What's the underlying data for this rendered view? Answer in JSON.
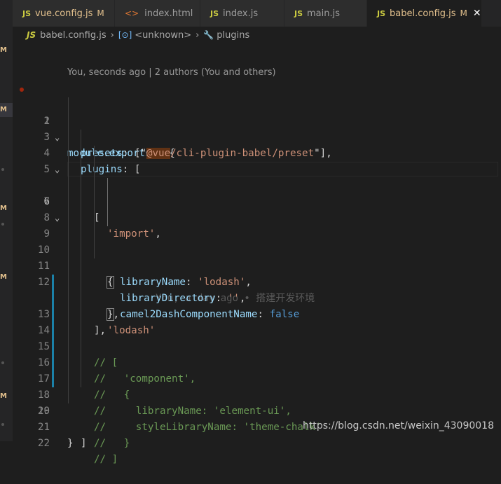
{
  "tabs": [
    {
      "type": "JS",
      "name": "vue.config.js",
      "badge": "M",
      "active": false
    },
    {
      "type": "HTML",
      "name": "index.html",
      "badge": "",
      "active": false
    },
    {
      "type": "JS",
      "name": "index.js",
      "badge": "",
      "active": false
    },
    {
      "type": "JS",
      "name": "main.js",
      "badge": "",
      "active": false
    },
    {
      "type": "JS",
      "name": "babel.config.js",
      "badge": "M",
      "active": true
    }
  ],
  "breadcrumb": {
    "file": "babel.config.js",
    "symbol": "<unknown>",
    "item": "plugins"
  },
  "blame": {
    "header": "You, seconds ago | 2 authors (You and others)",
    "inline": "You, a day ago • 搭建开发环境"
  },
  "lines": [
    "1",
    "2",
    "3",
    "4",
    "5",
    "6",
    "7",
    "8",
    "9",
    "10",
    "11",
    "12",
    "13",
    "14",
    "15",
    "16",
    "17",
    "18",
    "19",
    "20",
    "21",
    "22"
  ],
  "code": {
    "l1_module": "module",
    "l1_exports": "exports",
    "l1_rest": " = {",
    "l2_key": "presets",
    "l2_open": ": [\"",
    "l2_hl": "@vue",
    "l2_str": "/cli-plugin-babel/preset",
    "l2_close": "\"],",
    "l3_key": "plugins",
    "l3_rest": ": [",
    "l4": "[",
    "l5_str": "'import'",
    "l5_rest": ",",
    "l6": "{",
    "l7_key": "libraryName",
    "l7_str": "'lodash'",
    "l8_key": "libraryDirectory",
    "l8_str": "''",
    "l9_key": "camel2DashComponentName",
    "l9_val": "false",
    "l10_brace": "}",
    "l10_rest": ",",
    "l11_str": "'lodash'",
    "l12": "],",
    "l13": "// [",
    "l14": "//   'component',",
    "l15": "//   {",
    "l16": "//     libraryName: 'element-ui',",
    "l17": "//     styleLibraryName: 'theme-chalk'",
    "l18": "//   }",
    "l19": "// ]",
    "l20": "]",
    "l21": "}",
    "colon": ": ",
    "comma": ",",
    "dot": "."
  },
  "watermark": "https://blog.csdn.net/weixin_43090018",
  "colors": {
    "accent": "#1b81a8",
    "modified": "#e2c08d",
    "js_icon": "#cbcb41"
  }
}
